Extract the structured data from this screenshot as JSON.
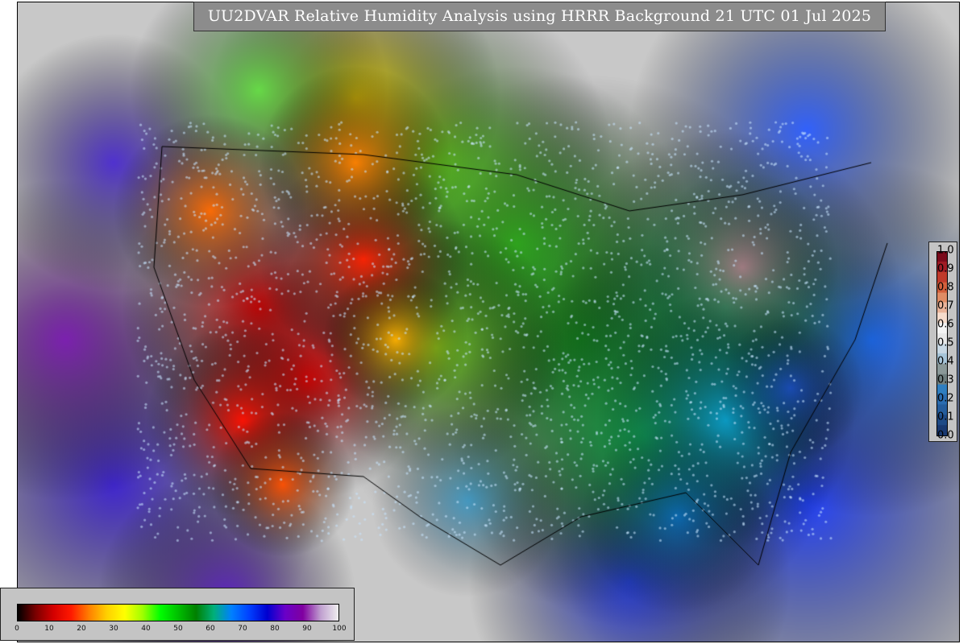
{
  "title": "UU2DVAR Relative Humidity Analysis using HRRR Background 21 UTC 01 Jul 2025",
  "rh_colorbar": {
    "ticks": [
      "0",
      "10",
      "20",
      "30",
      "40",
      "50",
      "60",
      "70",
      "80",
      "90",
      "100"
    ],
    "stops": [
      "#000000",
      "#7a0000",
      "#d40000",
      "#ff1a00",
      "#ff8000",
      "#ffd000",
      "#ffff00",
      "#a0ff00",
      "#00ff00",
      "#00c000",
      "#008000",
      "#00b07a",
      "#0080ff",
      "#0040ff",
      "#0000d0",
      "#6a00c8",
      "#8000a0",
      "#c0a0d0",
      "#f0f0f0"
    ]
  },
  "weight_colorbar": {
    "ticks": [
      "1.0",
      "0.9",
      "0.8",
      "0.7",
      "0.6",
      "0.5",
      "0.4",
      "0.3",
      "0.2",
      "0.1",
      "0.0"
    ],
    "bands_top_to_bottom": [
      "#7a0a1a",
      "#a01c24",
      "#c03a2a",
      "#d4603c",
      "#e08c64",
      "#eab49a",
      "#f6dccc",
      "#f4f4f4",
      "#e8e8e8",
      "#c8d8e4",
      "#a6c4d8",
      "#8a9898",
      "#6e7e7e",
      "#2e7ec0",
      "#2a6cb0",
      "#245c9c",
      "#1e4a86",
      "#183870"
    ]
  },
  "colors": {
    "land_background": "#c8c8c8",
    "ocean_humid": "#1b3cff",
    "dry_west": "#e30000",
    "moist_east": "#10b010",
    "station_obs": "#c8e6ff"
  }
}
